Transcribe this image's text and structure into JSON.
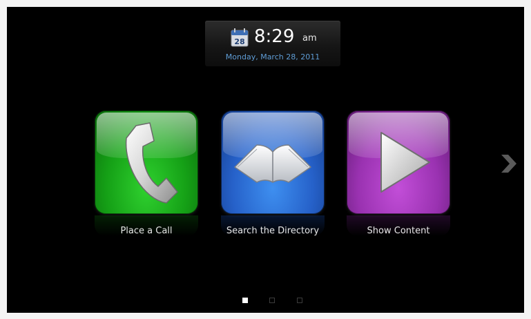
{
  "clock": {
    "calendar_day": "28",
    "time": "8:29",
    "ampm": "am",
    "date": "Monday, March 28, 2011"
  },
  "tiles": [
    {
      "label": "Place a Call",
      "icon": "phone-handset-icon",
      "color": "#18a61a"
    },
    {
      "label": "Search the Directory",
      "icon": "open-book-icon",
      "color": "#2f6fd6"
    },
    {
      "label": "Show Content",
      "icon": "play-icon",
      "color": "#a236b8"
    }
  ],
  "navigation": {
    "next_icon": "chevron-right-icon",
    "pages_total": 3,
    "current_page": 1
  },
  "colors": {
    "background": "#000000",
    "date_text": "#5f9dd6",
    "call_tile": "#18a61a",
    "directory_tile": "#2f6fd6",
    "content_tile": "#a236b8"
  }
}
